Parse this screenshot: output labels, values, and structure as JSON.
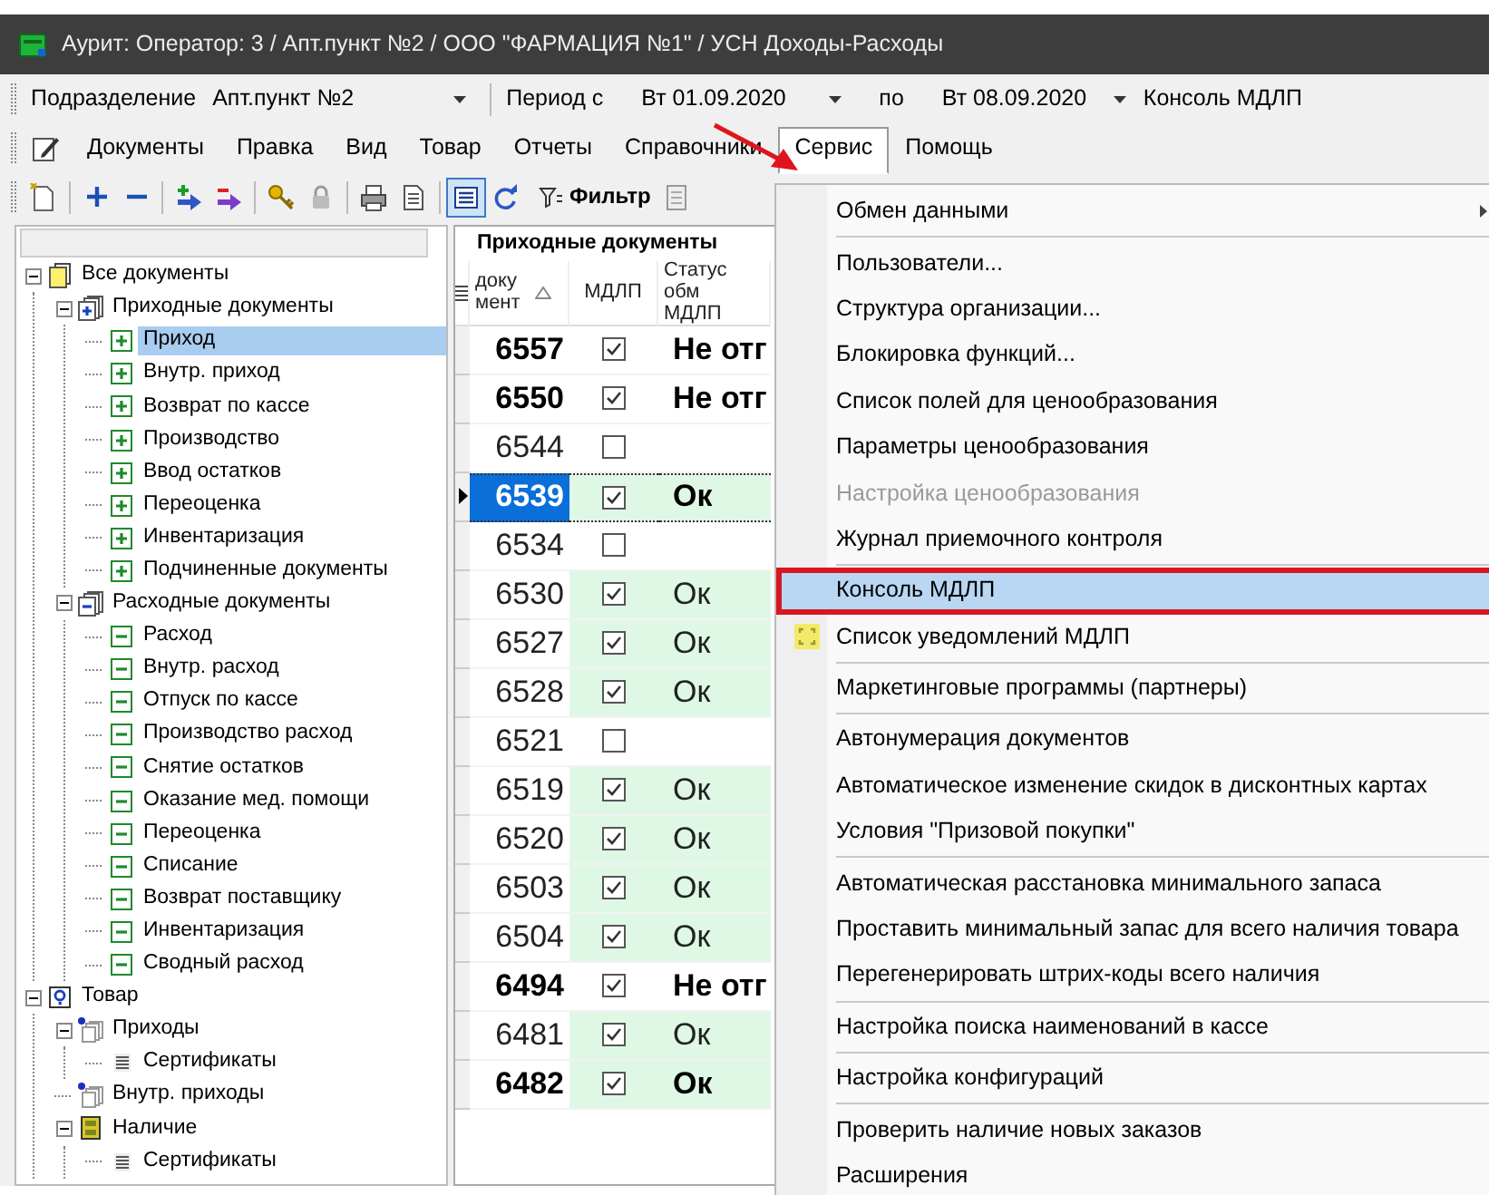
{
  "window": {
    "title": "Аурит: Оператор: 3 / Апт.пункт №2 / ООО \"ФАРМАЦИЯ №1\" / УСН Доходы-Расходы"
  },
  "filter_bar": {
    "department_label": "Подразделение",
    "department": "Апт.пункт №2",
    "period_from_label": "Период с",
    "period_from": "Вт 01.09.2020",
    "period_to_label": "по",
    "period_to": "Вт 08.09.2020",
    "console_button": "Консоль МДЛП"
  },
  "menu_bar": [
    {
      "label": "Документы",
      "selected": false
    },
    {
      "label": "Правка",
      "selected": false
    },
    {
      "label": "Вид",
      "selected": false
    },
    {
      "label": "Товар",
      "selected": false
    },
    {
      "label": "Отчеты",
      "selected": false
    },
    {
      "label": "Справочники",
      "selected": false
    },
    {
      "label": "Сервис",
      "selected": true
    },
    {
      "label": "Помощь",
      "selected": false
    }
  ],
  "toolbar": {
    "buttons": [
      {
        "pressed": false
      },
      {
        "pressed": false
      },
      {
        "pressed": false
      },
      {
        "pressed": false
      },
      {
        "pressed": false
      },
      {
        "pressed": false
      },
      {
        "pressed": false
      },
      {
        "pressed": false
      },
      {
        "pressed": false
      },
      {
        "pressed": true
      },
      {
        "pressed": false
      }
    ],
    "filter": "Фильтр"
  },
  "tree": [
    {
      "label": "Все документы",
      "kind": "folder",
      "expanded": true,
      "selected": false,
      "children": [
        {
          "label": "Приходные документы",
          "kind": "incoming",
          "expanded": true,
          "selected": false,
          "children": [
            {
              "label": "Приход",
              "kind": "receipt",
              "selected": true
            },
            {
              "label": "Внутр. приход",
              "kind": "receipt",
              "selected": false
            },
            {
              "label": "Возврат по кассе",
              "kind": "receipt",
              "selected": false
            },
            {
              "label": "Производство",
              "kind": "receipt",
              "selected": false
            },
            {
              "label": "Ввод остатков",
              "kind": "receipt",
              "selected": false
            },
            {
              "label": "Переоценка",
              "kind": "receipt",
              "selected": false
            },
            {
              "label": "Инвентаризация",
              "kind": "receipt",
              "selected": false
            },
            {
              "label": "Подчиненные документы",
              "kind": "receipt",
              "selected": false
            }
          ]
        },
        {
          "label": "Расходные документы",
          "kind": "outgoing",
          "expanded": true,
          "selected": false,
          "children": [
            {
              "label": "Расход",
              "kind": "expense",
              "selected": false
            },
            {
              "label": "Внутр. расход",
              "kind": "expense",
              "selected": false
            },
            {
              "label": "Отпуск по кассе",
              "kind": "expense",
              "selected": false
            },
            {
              "label": "Производство расход",
              "kind": "expense",
              "selected": false
            },
            {
              "label": "Снятие остатков",
              "kind": "expense",
              "selected": false
            },
            {
              "label": "Оказание мед. помощи",
              "kind": "expense",
              "selected": false
            },
            {
              "label": "Переоценка",
              "kind": "expense",
              "selected": false
            },
            {
              "label": "Списание",
              "kind": "expense",
              "selected": false
            },
            {
              "label": "Возврат поставщику",
              "kind": "expense",
              "selected": false
            },
            {
              "label": "Инвентаризация",
              "kind": "expense",
              "selected": false
            },
            {
              "label": "Сводный расход",
              "kind": "expense",
              "selected": false
            }
          ]
        }
      ]
    },
    {
      "label": "Товар",
      "kind": "query",
      "expanded": true,
      "selected": false,
      "children": [
        {
          "label": "Приходы",
          "kind": "stack",
          "expanded": true,
          "selected": false,
          "children": [
            {
              "label": "Сертификаты",
              "kind": "sheet",
              "selected": false
            }
          ]
        },
        {
          "label": "Внутр. приходы",
          "kind": "stack",
          "selected": false
        },
        {
          "label": "Наличие",
          "kind": "cabinet",
          "expanded": true,
          "selected": false,
          "children": [
            {
              "label": "Сертификаты",
              "kind": "sheet",
              "selected": false
            }
          ]
        }
      ]
    }
  ],
  "grid": {
    "title": "Приходные документы",
    "columns": [
      {
        "label": "доку\nмент",
        "sorted": true
      },
      {
        "label": "МДЛП",
        "sorted": false
      },
      {
        "label": "Статус обм\nМДЛП",
        "sorted": false
      }
    ],
    "rows": [
      {
        "number": "6557",
        "mdlp": true,
        "status": "Не отг",
        "bold": true,
        "highlighted": false,
        "selected": false
      },
      {
        "number": "6550",
        "mdlp": true,
        "status": "Не отг",
        "bold": true,
        "highlighted": false,
        "selected": false
      },
      {
        "number": "6544",
        "mdlp": false,
        "bold": false,
        "highlighted": false,
        "selected": false
      },
      {
        "number": "6539",
        "mdlp": true,
        "status": "Ок",
        "bold": true,
        "highlighted": true,
        "selected": true
      },
      {
        "number": "6534",
        "mdlp": false,
        "bold": false,
        "highlighted": false,
        "selected": false
      },
      {
        "number": "6530",
        "mdlp": true,
        "status": "Ок",
        "bold": false,
        "highlighted": true,
        "selected": false
      },
      {
        "number": "6527",
        "mdlp": true,
        "status": "Ок",
        "bold": false,
        "highlighted": true,
        "selected": false
      },
      {
        "number": "6528",
        "mdlp": true,
        "status": "Ок",
        "bold": false,
        "highlighted": true,
        "selected": false
      },
      {
        "number": "6521",
        "mdlp": false,
        "bold": false,
        "highlighted": false,
        "selected": false
      },
      {
        "number": "6519",
        "mdlp": true,
        "status": "Ок",
        "bold": false,
        "highlighted": true,
        "selected": false
      },
      {
        "number": "6520",
        "mdlp": true,
        "status": "Ок",
        "bold": false,
        "highlighted": true,
        "selected": false
      },
      {
        "number": "6503",
        "mdlp": true,
        "status": "Ок",
        "bold": false,
        "highlighted": true,
        "selected": false
      },
      {
        "number": "6504",
        "mdlp": true,
        "status": "Ок",
        "bold": false,
        "highlighted": true,
        "selected": false
      },
      {
        "number": "6494",
        "mdlp": true,
        "status": "Не отг",
        "bold": true,
        "highlighted": false,
        "selected": false
      },
      {
        "number": "6481",
        "mdlp": true,
        "status": "Ок",
        "bold": false,
        "highlighted": true,
        "selected": false
      },
      {
        "number": "6482",
        "mdlp": true,
        "status": "Ок",
        "bold": true,
        "highlighted": true,
        "selected": false
      }
    ]
  },
  "service_menu": {
    "groups": [
      [
        {
          "label": "Обмен данными",
          "selected": false,
          "disabled": false,
          "submenu": true
        }
      ],
      [
        {
          "label": "Пользователи...",
          "selected": false,
          "disabled": false
        },
        {
          "label": "Структура организации...",
          "selected": false,
          "disabled": false
        },
        {
          "label": "Блокировка функций...",
          "selected": false,
          "disabled": false
        },
        {
          "label": "Список полей для ценообразования",
          "selected": false,
          "disabled": false
        },
        {
          "label": "Параметры ценообразования",
          "selected": false,
          "disabled": false
        },
        {
          "label": "Настройка ценообразования",
          "selected": false,
          "disabled": true
        },
        {
          "label": "Журнал приемочного контроля",
          "selected": false,
          "disabled": false
        }
      ],
      [
        {
          "label": "Консоль МДЛП",
          "selected": true,
          "disabled": false
        },
        {
          "label": "Список уведомлений МДЛП",
          "selected": false,
          "disabled": false,
          "icon": true
        }
      ],
      [
        {
          "label": "Маркетинговые программы (партнеры)",
          "selected": false,
          "disabled": false
        }
      ],
      [
        {
          "label": "Автонумерация документов",
          "selected": false,
          "disabled": false
        },
        {
          "label": "Автоматическое изменение скидок в дисконтных картах",
          "selected": false,
          "disabled": false
        },
        {
          "label": "Условия \"Призовой покупки\"",
          "selected": false,
          "disabled": false
        }
      ],
      [
        {
          "label": "Автоматическая расстановка минимального запаса",
          "selected": false,
          "disabled": false
        },
        {
          "label": "Проставить минимальный запас для всего наличия товара",
          "selected": false,
          "disabled": false
        },
        {
          "label": "Перегенерировать штрих-коды всего наличия",
          "selected": false,
          "disabled": false
        }
      ],
      [
        {
          "label": "Настройка поиска наименований в кассе",
          "selected": false,
          "disabled": false
        }
      ],
      [
        {
          "label": "Настройка конфигураций",
          "selected": false,
          "disabled": false
        }
      ],
      [
        {
          "label": "Проверить наличие новых заказов",
          "selected": false,
          "disabled": false
        },
        {
          "label": "Расширения",
          "selected": false,
          "disabled": false
        }
      ]
    ]
  }
}
